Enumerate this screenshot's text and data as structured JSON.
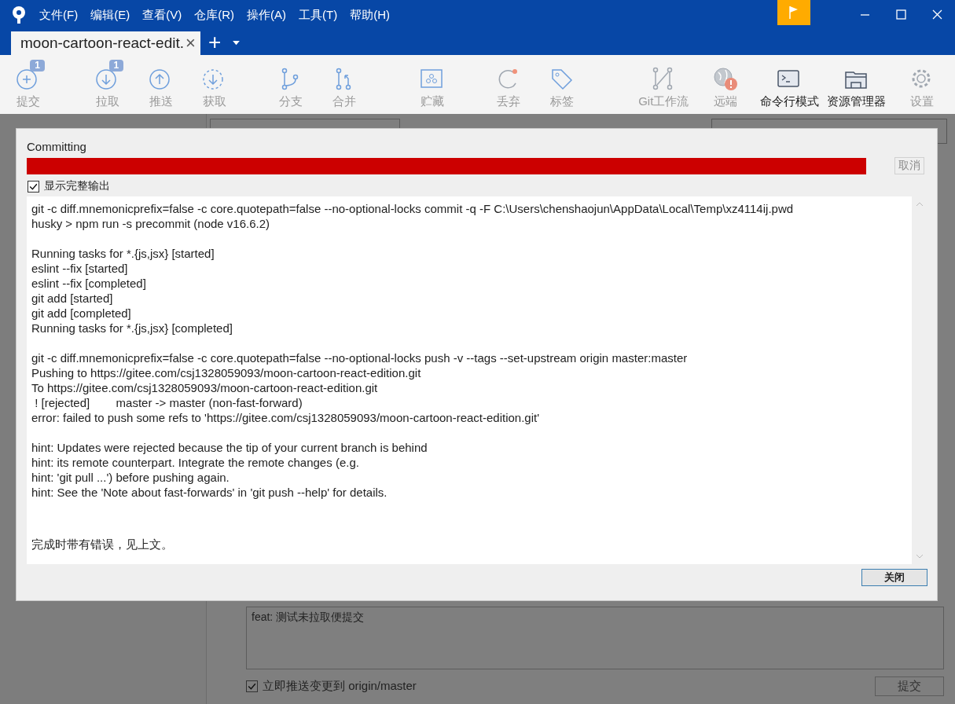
{
  "window": {
    "menu": [
      "文件(F)",
      "编辑(E)",
      "查看(V)",
      "仓库(R)",
      "操作(A)",
      "工具(T)",
      "帮助(H)"
    ],
    "flag_active": true
  },
  "tabs": [
    {
      "label": "moon-cartoon-react-edit.",
      "selected": true,
      "close": "×"
    }
  ],
  "tab_add": "+",
  "toolbar": [
    {
      "kind": "commit",
      "label": "提交",
      "badge": "1",
      "enabled": false
    },
    {
      "kind": "pull",
      "label": "拉取",
      "badge": "1",
      "enabled": false
    },
    {
      "kind": "push",
      "label": "推送",
      "enabled": false
    },
    {
      "kind": "fetch",
      "label": "获取",
      "enabled": false
    },
    {
      "kind": "branch",
      "label": "分支",
      "enabled": false
    },
    {
      "kind": "merge",
      "label": "合并",
      "enabled": false
    },
    {
      "kind": "stash",
      "label": "贮藏",
      "enabled": false
    },
    {
      "kind": "discard",
      "label": "丢弃",
      "enabled": false
    },
    {
      "kind": "tag",
      "label": "标签",
      "enabled": false
    },
    {
      "kind": "flow",
      "label": "Git工作流",
      "enabled": false
    },
    {
      "kind": "remote",
      "label": "远端",
      "enabled": false
    },
    {
      "kind": "terminal",
      "label": "命令行模式",
      "enabled": true
    },
    {
      "kind": "explorer",
      "label": "资源管理器",
      "enabled": true
    },
    {
      "kind": "settings",
      "label": "设置",
      "enabled": false
    }
  ],
  "commit_box": {
    "message": "feat: 测试未拉取便提交",
    "push_now": {
      "label": "立即推送变更到 origin/master",
      "checked": true
    },
    "commit_button": "提交"
  },
  "dialog": {
    "title": "Committing",
    "progress": {
      "level": 1,
      "failed": true
    },
    "cancel": "取消",
    "show_full_output": {
      "label": "显示完整输出",
      "checked": true
    },
    "output_blocks": [
      [
        "git -c diff.mnemonicprefix=false -c core.quotepath=false --no-optional-locks commit -q -F C:\\Users\\chenshaojun\\AppData\\Local\\Temp\\xz4114ij.pwd",
        "husky > npm run -s precommit (node v16.6.2)"
      ],
      [
        "Running tasks for *.{js,jsx} [started]",
        "eslint --fix [started]",
        "eslint --fix [completed]",
        "git add [started]",
        "git add [completed]",
        "Running tasks for *.{js,jsx} [completed]"
      ],
      [
        "git -c diff.mnemonicprefix=false -c core.quotepath=false --no-optional-locks push -v --tags --set-upstream origin master:master",
        "Pushing to https://gitee.com/csj1328059093/moon-cartoon-react-edition.git",
        "To https://gitee.com/csj1328059093/moon-cartoon-react-edition.git",
        " ! [rejected]        master -> master (non-fast-forward)",
        "error: failed to push some refs to 'https://gitee.com/csj1328059093/moon-cartoon-react-edition.git'"
      ],
      [
        "hint: Updates were rejected because the tip of your current branch is behind",
        "hint: its remote counterpart. Integrate the remote changes (e.g.",
        "hint: 'git pull ...') before pushing again.",
        "hint: See the 'Note about fast-forwards' in 'git push --help' for details."
      ]
    ],
    "result": "完成时带有错误，见上文。",
    "close": "关闭"
  }
}
